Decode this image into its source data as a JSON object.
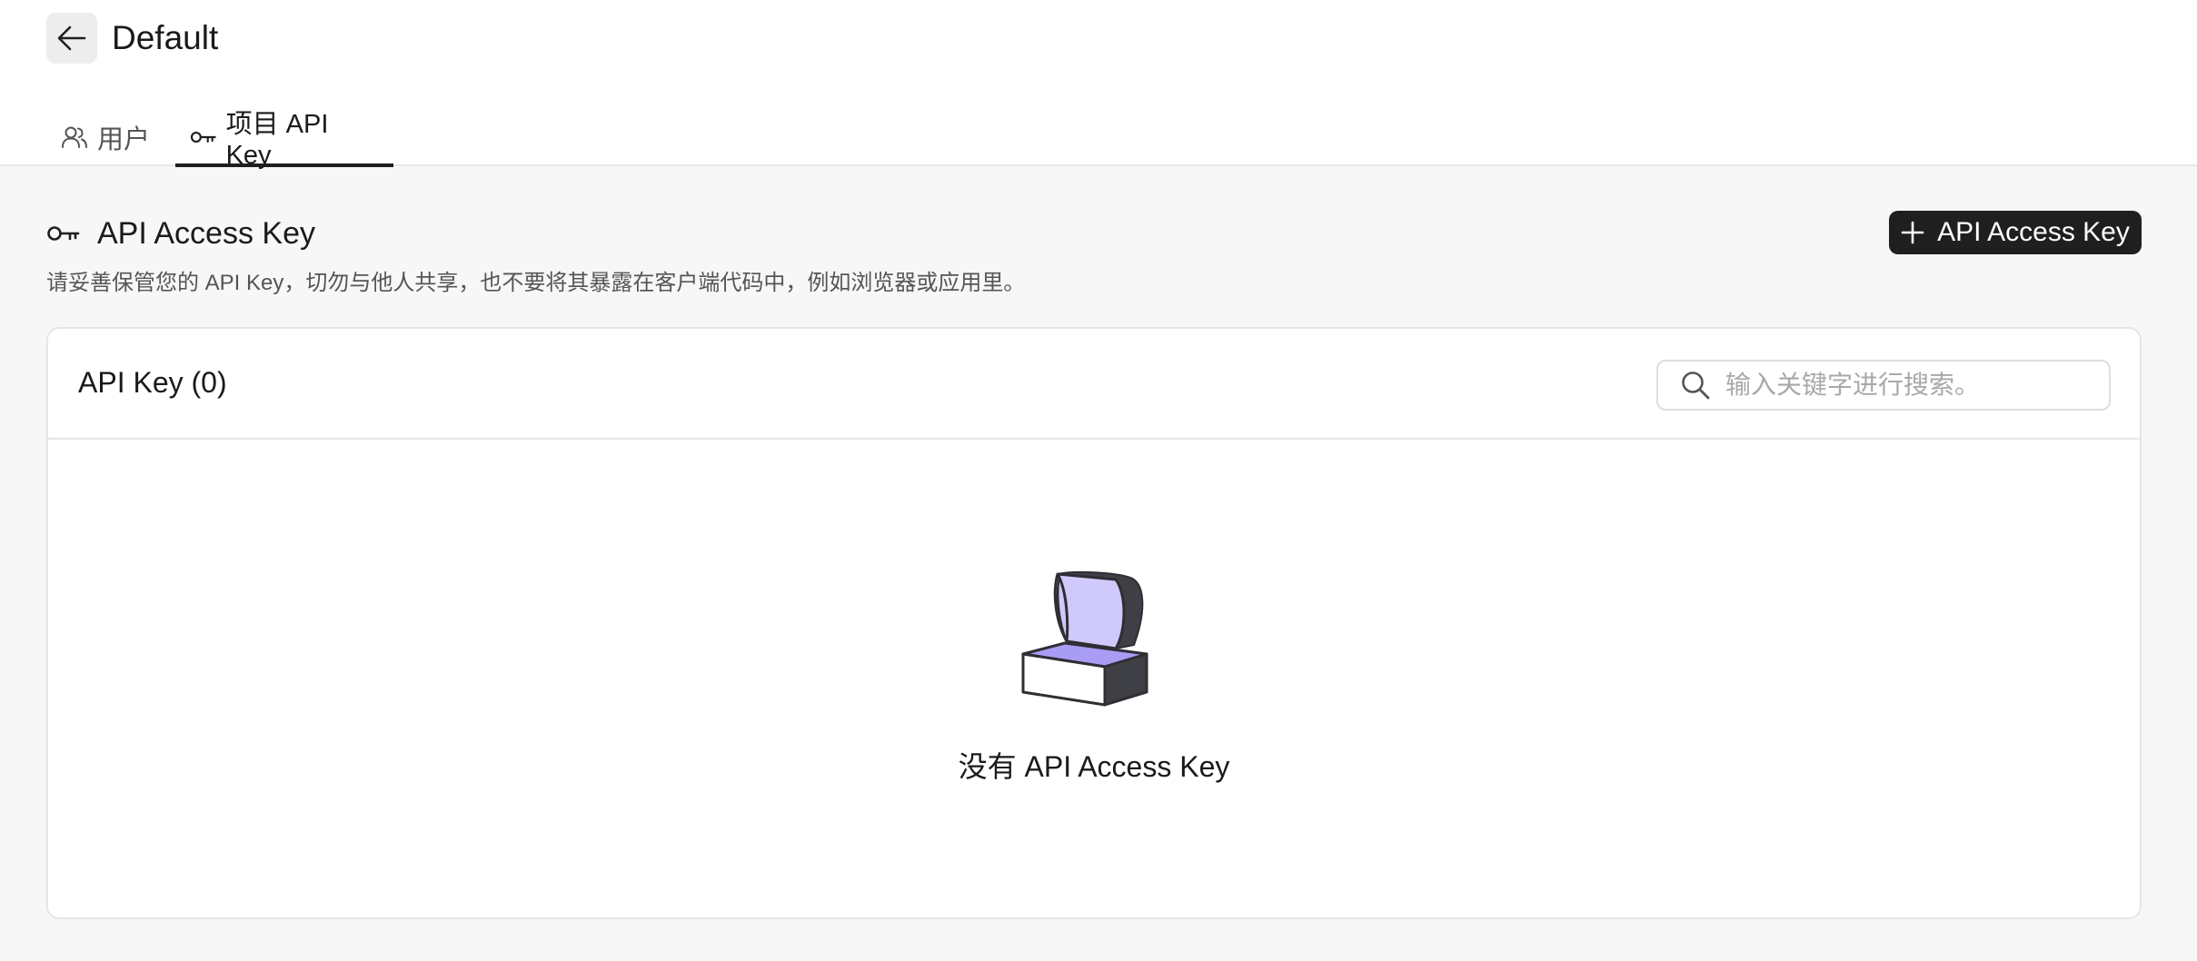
{
  "header": {
    "title": "Default"
  },
  "tabs": [
    {
      "label": "用户",
      "icon": "users-icon",
      "active": false
    },
    {
      "label": "项目 API Key",
      "icon": "key-icon",
      "active": true
    }
  ],
  "section": {
    "title": "API Access Key",
    "icon": "key-icon",
    "add_button_label": "API Access Key",
    "description": "请妥善保管您的 API Key，切勿与他人共享，也不要将其暴露在客户端代码中，例如浏览器或应用里。"
  },
  "card": {
    "title": "API Key (0)",
    "search_placeholder": "输入关键字进行搜索。",
    "search_value": "",
    "empty_text": "没有 API Access Key",
    "empty_icon": "open-chest-icon"
  },
  "colors": {
    "primary_button_bg": "#1f1f1f",
    "page_bg": "#f7f7f7",
    "chest_purple": "#a89cf5",
    "chest_lid": "#cfcafb",
    "chest_dark": "#3f3f46"
  }
}
